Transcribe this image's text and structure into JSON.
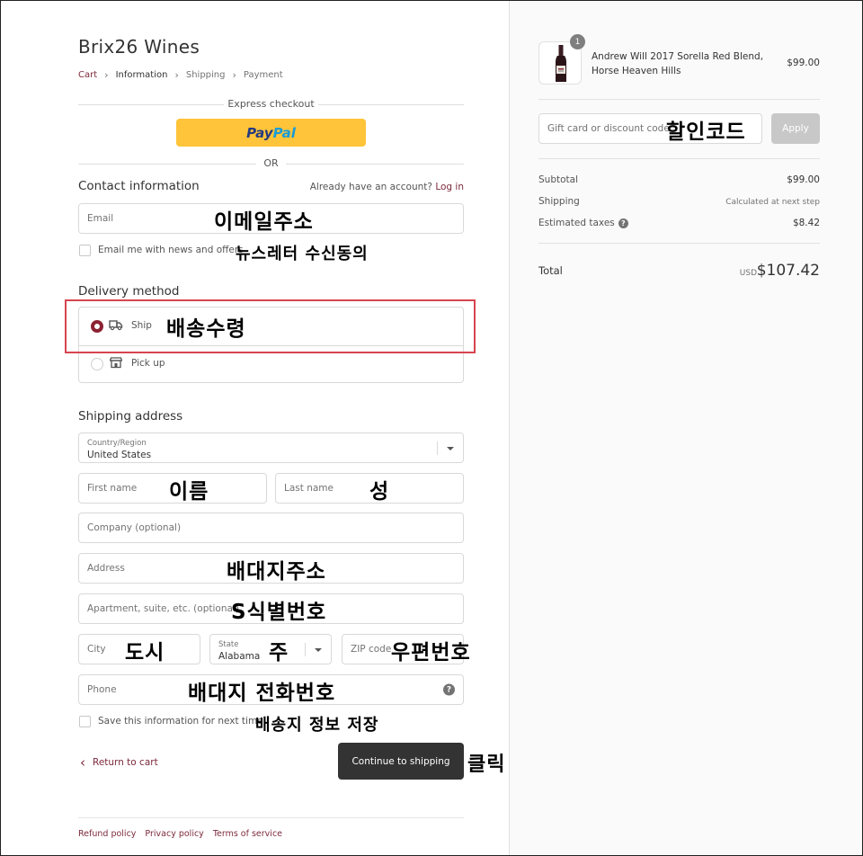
{
  "shop": {
    "title": "Brix26 Wines"
  },
  "breadcrumb": [
    "Cart",
    "Information",
    "Shipping",
    "Payment"
  ],
  "express": {
    "label": "Express checkout",
    "paypal_part1": "Pay",
    "paypal_part2": "Pal",
    "or_label": "OR"
  },
  "contact": {
    "title": "Contact information",
    "login_prompt": "Already have an account?",
    "login_link": "Log in",
    "email_placeholder": "Email",
    "email_note": "이메일주소",
    "newsletter_label": "Email me with news and offers",
    "newsletter_note": "뉴스레터 수신동의"
  },
  "delivery": {
    "title": "Delivery method",
    "ship_label": "Ship",
    "ship_note": "배송수령",
    "pickup_label": "Pick up"
  },
  "shipping": {
    "title": "Shipping address",
    "country_label": "Country/Region",
    "country_value": "United States",
    "first_name": "First name",
    "first_name_note": "이름",
    "last_name": "Last name",
    "last_name_note": "성",
    "company": "Company (optional)",
    "address": "Address",
    "address_note": "배대지주소",
    "apartment": "Apartment, suite, etc. (optional)",
    "apartment_note": "S식별번호",
    "city": "City",
    "city_note": "도시",
    "state_label": "State",
    "state_value": "Alabama",
    "state_note": "주",
    "zip": "ZIP code",
    "zip_note": "우편번호",
    "phone": "Phone",
    "phone_note": "배대지 전화번호",
    "help_glyph": "?",
    "save_label": "Save this information for next time",
    "save_note": "배송지 정보 저장"
  },
  "actions": {
    "return_label": "Return to cart",
    "return_chevron": "‹",
    "continue_label": "Continue to shipping",
    "continue_note": "클릭"
  },
  "footer": [
    "Refund policy",
    "Privacy policy",
    "Terms of service"
  ],
  "summary": {
    "product_name": "Andrew Will 2017 Sorella Red Blend, Horse Heaven Hills",
    "product_price": "$99.00",
    "quantity": "1",
    "discount_placeholder": "Gift card or discount code",
    "discount_note": "할인코드",
    "apply_label": "Apply",
    "subtotal_label": "Subtotal",
    "subtotal_value": "$99.00",
    "shipping_label": "Shipping",
    "shipping_value": "Calculated at next step",
    "taxes_label": "Estimated taxes",
    "taxes_value": "$8.42",
    "total_label": "Total",
    "currency": "USD",
    "total_value": "$107.42"
  },
  "colors": {
    "accent": "#7d2a3b",
    "radio": "#8c2233",
    "paypal": "#ffc439",
    "highlight": "#d6454f",
    "button": "#333333"
  }
}
